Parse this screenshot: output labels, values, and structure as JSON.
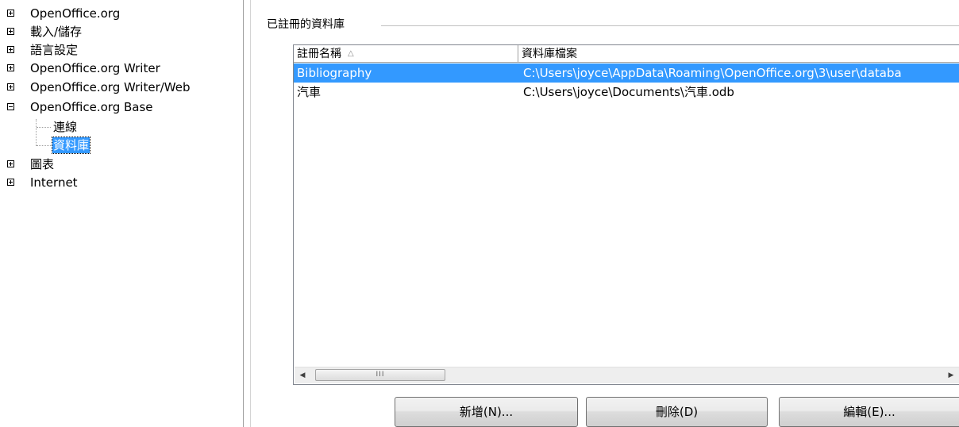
{
  "tree": {
    "items": [
      {
        "label": "OpenOffice.org",
        "expanded": false
      },
      {
        "label": "載入/儲存",
        "expanded": false
      },
      {
        "label": "語言設定",
        "expanded": false
      },
      {
        "label": "OpenOffice.org Writer",
        "expanded": false
      },
      {
        "label": "OpenOffice.org Writer/Web",
        "expanded": false
      },
      {
        "label": "OpenOffice.org Base",
        "expanded": true,
        "children": [
          {
            "label": "連線",
            "selected": false
          },
          {
            "label": "資料庫",
            "selected": true
          }
        ]
      },
      {
        "label": "圖表",
        "expanded": false
      },
      {
        "label": "Internet",
        "expanded": false
      }
    ]
  },
  "group": {
    "title": "已註冊的資料庫"
  },
  "list": {
    "columns": [
      "註冊名稱",
      "資料庫檔案"
    ],
    "sort_icon": "sort-ascending-icon",
    "rows": [
      {
        "name": "Bibliography",
        "file": "C:\\Users\\joyce\\AppData\\Roaming\\OpenOffice.org\\3\\user\\databa",
        "selected": true
      },
      {
        "name": "汽車",
        "file": "C:\\Users\\joyce\\Documents\\汽車.odb",
        "selected": false
      }
    ]
  },
  "scrollbar": {
    "left_arrow": "◀",
    "right_arrow": "▶",
    "grip": "III"
  },
  "buttons": {
    "new_label": "新增(N)...",
    "delete_label": "刪除(D)",
    "edit_label": "編輯(E)..."
  },
  "colors": {
    "selection": "#3399ff"
  }
}
